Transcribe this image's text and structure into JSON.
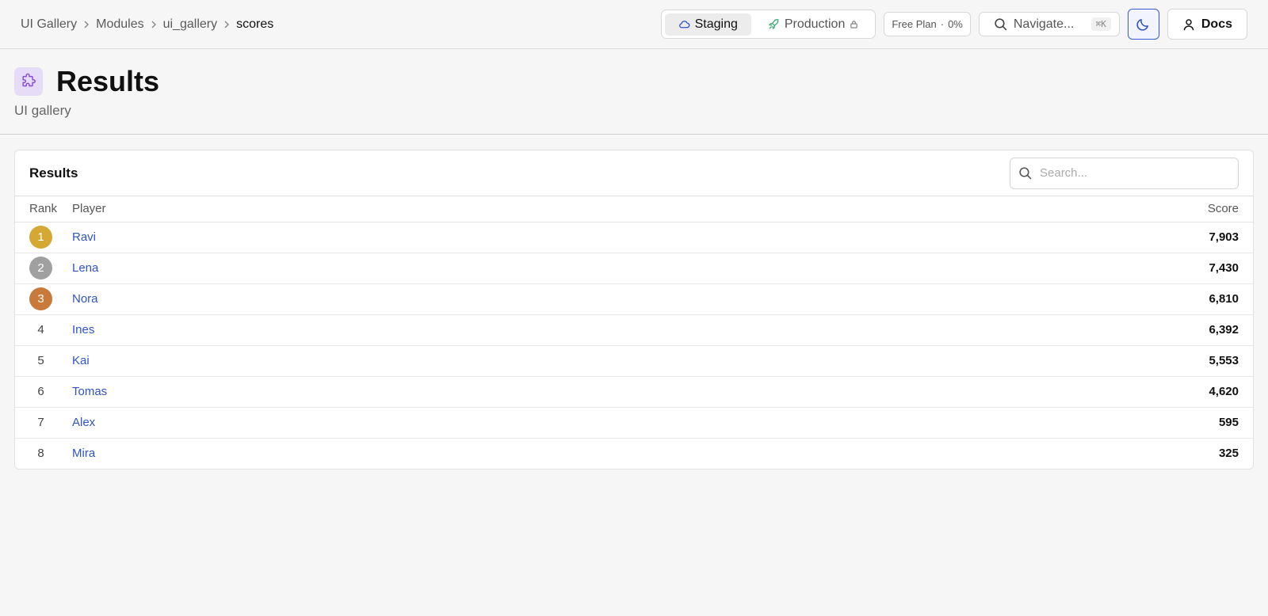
{
  "breadcrumb": [
    "UI Gallery",
    "Modules",
    "ui_gallery",
    "scores"
  ],
  "env": {
    "staging_label": "Staging",
    "production_label": "Production"
  },
  "plan": {
    "label": "Free Plan",
    "separator": "·",
    "usage": "0%"
  },
  "navigate": {
    "label": "Navigate...",
    "shortcut": "⌘K"
  },
  "docs_label": "Docs",
  "header": {
    "title": "Results",
    "subtitle": "UI gallery"
  },
  "card": {
    "title": "Results",
    "search_placeholder": "Search..."
  },
  "table": {
    "columns": [
      "Rank",
      "Player",
      "Score"
    ],
    "rows": [
      {
        "rank": "1",
        "player": "Ravi",
        "score": "7,903",
        "medal": "#d4a833"
      },
      {
        "rank": "2",
        "player": "Lena",
        "score": "7,430",
        "medal": "#a0a0a0"
      },
      {
        "rank": "3",
        "player": "Nora",
        "score": "6,810",
        "medal": "#c87a3a"
      },
      {
        "rank": "4",
        "player": "Ines",
        "score": "6,392"
      },
      {
        "rank": "5",
        "player": "Kai",
        "score": "5,553"
      },
      {
        "rank": "6",
        "player": "Tomas",
        "score": "4,620"
      },
      {
        "rank": "7",
        "player": "Alex",
        "score": "595"
      },
      {
        "rank": "8",
        "player": "Mira",
        "score": "325"
      }
    ]
  },
  "colors": {
    "accent": "#2f53c9",
    "module_icon_bg": "#e6dcf7",
    "module_icon": "#8a4fd8"
  },
  "icons": {
    "staging": "cloud-icon",
    "production": "rocket-icon",
    "lock": "lock-icon",
    "navigate": "search-icon",
    "theme": "moon-icon",
    "docs": "user-icon",
    "module": "puzzle-icon",
    "search": "search-icon"
  }
}
